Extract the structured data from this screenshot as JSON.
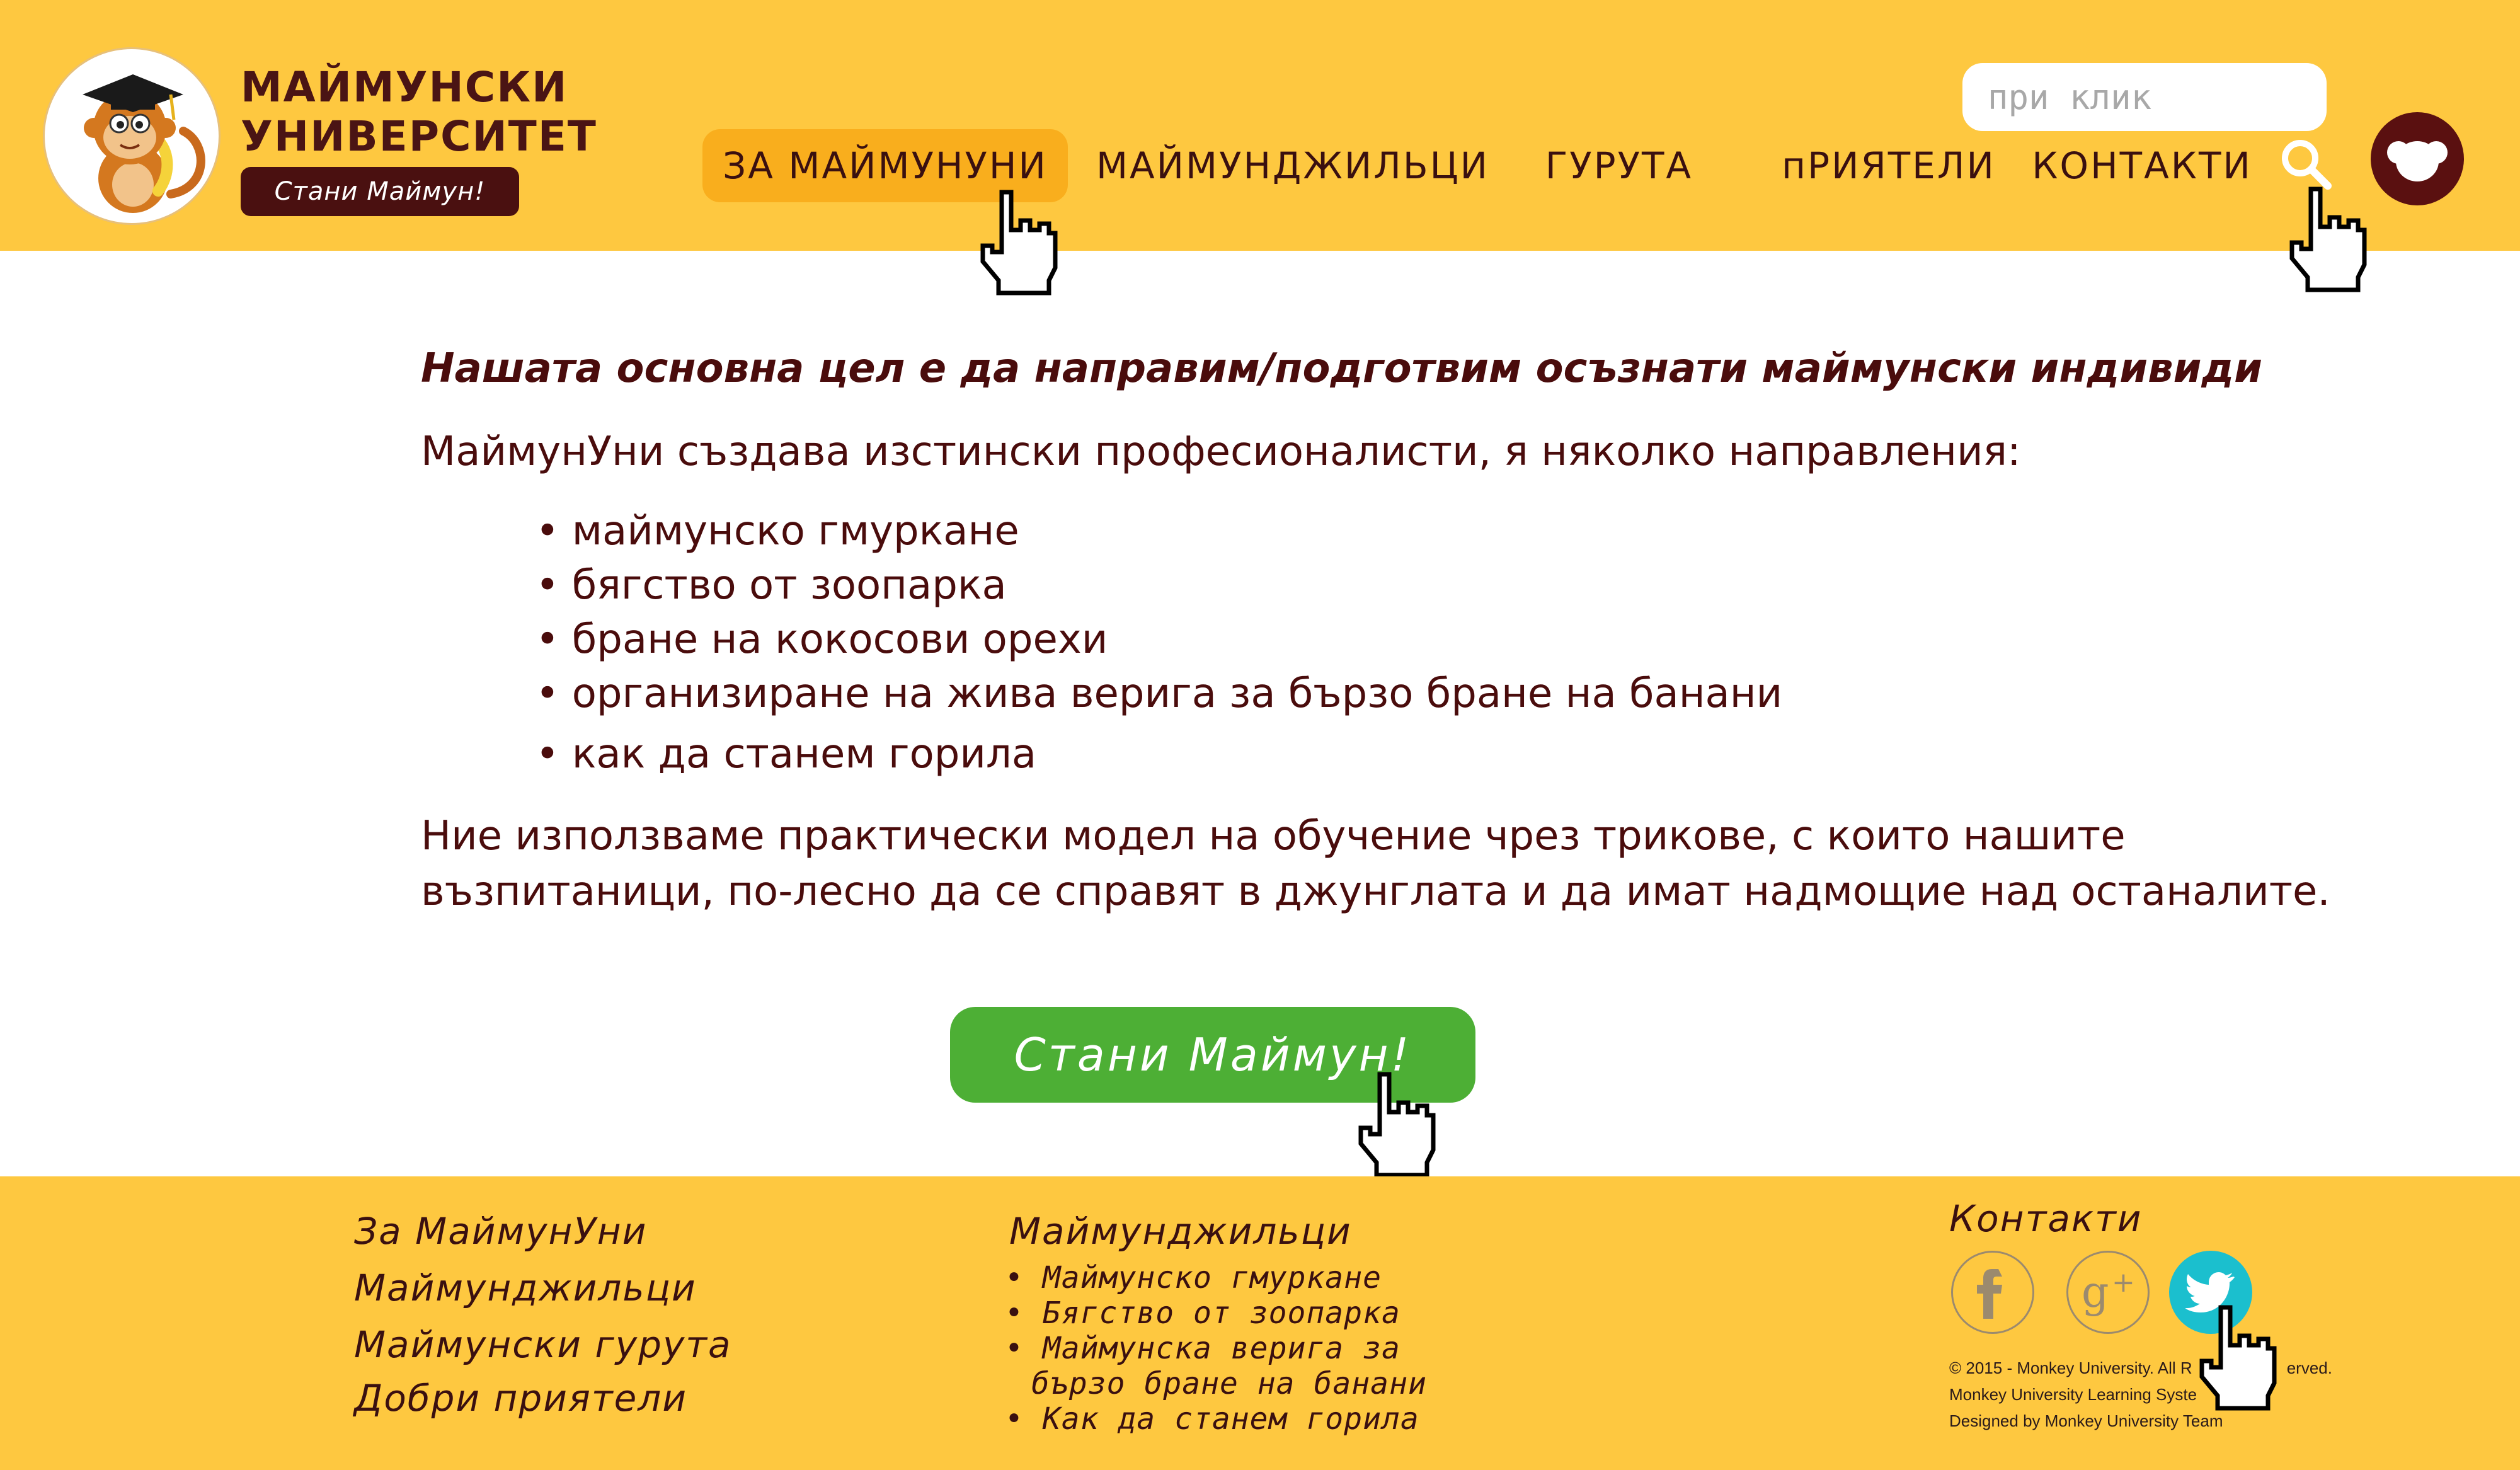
{
  "header": {
    "logo_line1": "МАЙМУНСКИ",
    "logo_line2": "УНИВЕРСИТЕТ",
    "logo_cta": "Стани Маймун!",
    "nav": [
      "ЗА МАЙМУНУНИ",
      "МАЙМУНДЖИЛЬЦИ",
      "ГУРУТА",
      "пРИЯТЕЛИ",
      "КОНТАКТИ"
    ],
    "search_placeholder": "при клик"
  },
  "main": {
    "heading": "Нашата основна цел е да направим/подготвим осъзнати маймунски индивиди",
    "intro": "МаймунУни създава изстински професионалисти, я няколко направления:",
    "bullets": [
      "маймунско  гмуркане",
      "бягство от зоопарка",
      "бране на кокосови орехи",
      "организиране на жива верига за бързо  бране на банани",
      "как да станем горила"
    ],
    "closing_line1": "Ние използваме практически модел на обучение чрез трикове,  с които нашите",
    "closing_line2": "възпитаници, по-лесно да се справят в джунглата и да имат надмощие над останалите.",
    "cta": "Стани Маймун!"
  },
  "footer": {
    "links": [
      "За МаймунУни",
      "Маймунджильци",
      "Маймунски гурута",
      "Добри приятели"
    ],
    "column_title": "Маймунджильци",
    "column_items": [
      "Маймунско гмуркане",
      "Бягство от зоопарка",
      "Маймунска верига за",
      "бързо бране на банани",
      "Как да станем горила"
    ],
    "contacts_title": "Контакти",
    "social": [
      "facebook-icon",
      "google-plus-icon",
      "twitter-icon"
    ],
    "copyright1": "© 2015 - Monkey University. All R",
    "copyright1_end": "erved.",
    "copyright2": "Monkey University Learning Syste",
    "copyright3": "Designed by Monkey University Team"
  },
  "colors": {
    "header_bg": "#fec840",
    "nav_active": "#f9ae1d",
    "text_dark": "#4a0c0c",
    "cta_green": "#4daf35",
    "twitter": "#1bbfce"
  }
}
